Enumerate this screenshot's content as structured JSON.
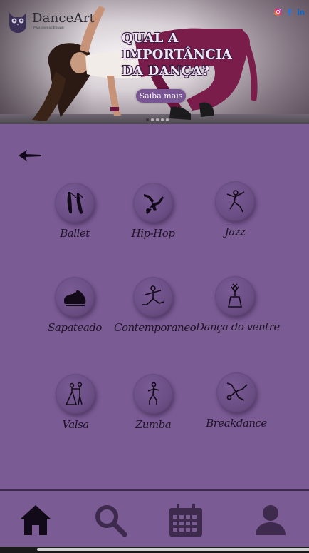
{
  "brand": {
    "name": "DanceArt",
    "tagline": "Para viver ao Ensaiar"
  },
  "social": {
    "icons": [
      "instagram-icon",
      "facebook-icon",
      "linkedin-icon"
    ]
  },
  "hero": {
    "headline": [
      "QUAL A",
      "IMPORTÂNCIA",
      "DA DANÇA?"
    ],
    "cta_label": "Saiba mais",
    "slides": 5,
    "active_slide": 1
  },
  "content": {
    "back_icon": "arrow-left-icon",
    "categories": [
      {
        "label": "Ballet",
        "icon": "ballet-shoes-icon"
      },
      {
        "label": "Hip-Hop",
        "icon": "hip-hop-dancer-icon"
      },
      {
        "label": "Jazz",
        "icon": "jazz-dancer-icon"
      },
      {
        "label": "Sapateado",
        "icon": "tap-shoe-icon"
      },
      {
        "label": "Contemporaneo",
        "icon": "contemporary-dancer-icon"
      },
      {
        "label": "Dança do ventre",
        "icon": "belly-dancer-icon"
      },
      {
        "label": "Valsa",
        "icon": "waltz-couple-icon"
      },
      {
        "label": "Zumba",
        "icon": "zumba-dancer-icon"
      },
      {
        "label": "Breakdance",
        "icon": "breakdancer-icon"
      }
    ]
  },
  "nav": {
    "items": [
      "home-icon",
      "search-icon",
      "calendar-icon",
      "user-icon"
    ],
    "active": "home-icon"
  },
  "colors": {
    "background": "#7a5b94",
    "cta": "#7a5595",
    "icon_dark": "#1e1426",
    "nav_inactive": "#3d2a4d"
  }
}
